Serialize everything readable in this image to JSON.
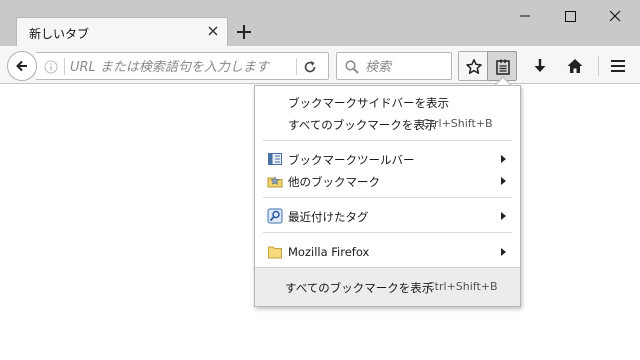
{
  "tab": {
    "title": "新しいタブ"
  },
  "urlbar": {
    "placeholder": "URL または検索語句を入力します"
  },
  "searchbar": {
    "placeholder": "検索"
  },
  "bookmarks_menu": {
    "items": [
      {
        "label": "ブックマークサイドバーを表示",
        "shortcut": ""
      },
      {
        "label": "すべてのブックマークを表示",
        "shortcut": "Ctrl+Shift+B"
      },
      {
        "label": "ブックマークツールバー",
        "shortcut": ""
      },
      {
        "label": "他のブックマーク",
        "shortcut": ""
      },
      {
        "label": "最近付けたタグ",
        "shortcut": ""
      },
      {
        "label": "Mozilla Firefox",
        "shortcut": ""
      }
    ],
    "footer": {
      "label": "すべてのブックマークを表示",
      "shortcut": "Ctrl+Shift+B"
    }
  },
  "colors": {
    "titlebar": "#c9c9c9",
    "toolbar": "#f5f6f7",
    "pressed_button": "#d6d6d6",
    "footer": "#ececec"
  }
}
